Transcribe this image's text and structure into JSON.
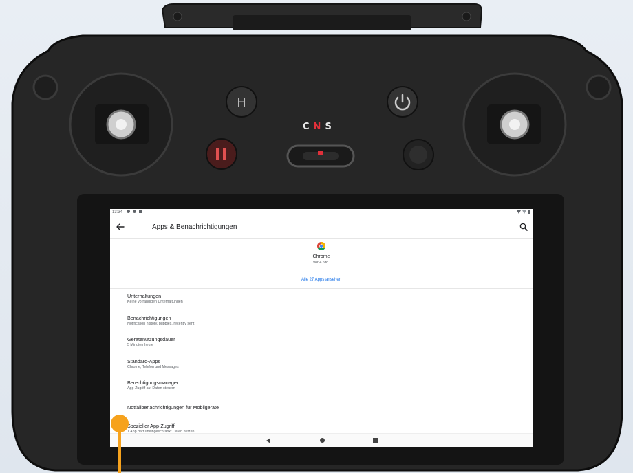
{
  "status_bar": {
    "time": "13:34",
    "left_icons": [
      "settings-icon",
      "shield-icon",
      "sd-card-icon"
    ],
    "right_icons": [
      "wifi-icon",
      "signal-icon",
      "battery-icon"
    ]
  },
  "app_bar": {
    "title": "Apps & Benachrichtigungen"
  },
  "recent_app": {
    "name": "Chrome",
    "time": "vor 4 Std."
  },
  "see_all_label": "Alle 27 Apps ansehen",
  "settings_items": [
    {
      "title": "Unterhaltungen",
      "subtitle": "Keine vorrangigen Unterhaltungen"
    },
    {
      "title": "Benachrichtigungen",
      "subtitle": "Notification history, bubbles, recently sent"
    },
    {
      "title": "Gerätenutzungsdauer",
      "subtitle": "5 Minuten heute"
    },
    {
      "title": "Standard-Apps",
      "subtitle": "Chrome, Telefon und Messages"
    },
    {
      "title": "Berechtigungsmanager",
      "subtitle": "App-Zugriff auf Daten steuern"
    },
    {
      "title": "Notfallbenachrichtigungen für Mobilgeräte",
      "subtitle": ""
    },
    {
      "title": "Spezieller App-Zugriff",
      "subtitle": "1 App darf uneingeschränkt Daten nutzen"
    }
  ],
  "controller": {
    "mode_labels": [
      "C",
      "N",
      "S"
    ],
    "mode_active": "N"
  },
  "colors": {
    "accent_link": "#1a73e8",
    "marker": "#f6a21d",
    "mode_active": "#e0303a"
  }
}
